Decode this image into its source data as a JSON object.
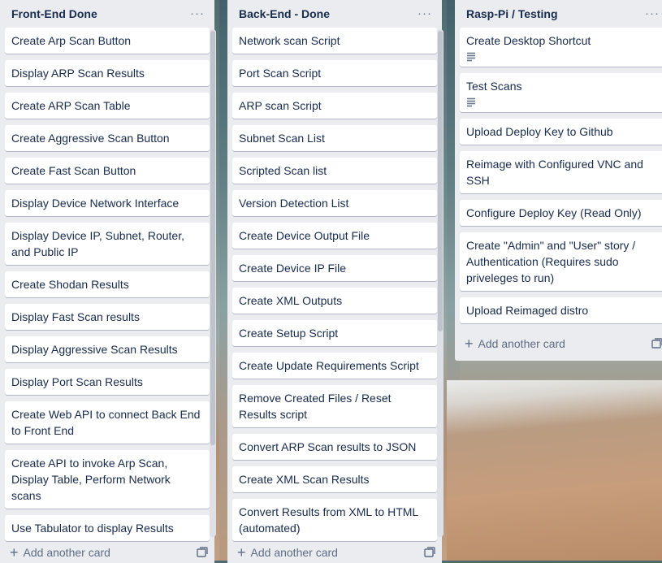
{
  "lists": [
    {
      "title": "Front-End Done",
      "cards": [
        "Create Arp Scan Button",
        "Display ARP Scan Results",
        "Create ARP Scan Table",
        "Create Aggressive Scan Button",
        "Create Fast Scan Button",
        "Display Device Network Interface",
        "Display Device IP, Subnet, Router, and Public IP",
        "Create Shodan Results",
        "Display Fast Scan results",
        "Display Aggressive Scan Results",
        "Display Port Scan Results",
        "Create Web API to connect Back End to Front End",
        "Create API to invoke Arp Scan, Display Table, Perform Network scans",
        "Use Tabulator to display Results"
      ],
      "add_label": "Add another card"
    },
    {
      "title": "Back-End - Done",
      "cards": [
        "Network scan Script",
        "Port Scan Script",
        "ARP scan Script",
        "Subnet Scan List",
        "Scripted Scan list",
        "Version Detection List",
        "Create Device Output File",
        "Create Device IP File",
        "Create XML Outputs",
        "Create Setup Script",
        "Create Update Requirements Script",
        "Remove Created Files / Reset Results script",
        "Convert ARP Scan results to JSON",
        "Create XML Scan Results",
        "Convert Results from XML to HTML (automated)"
      ],
      "add_label": "Add another card"
    },
    {
      "title": "Rasp-Pi / Testing",
      "cards": [
        "Create Desktop Shortcut",
        "Test Scans",
        "Upload Deploy Key to Github",
        "Reimage with Configured VNC and SSH",
        "Configure Deploy Key (Read Only)",
        "Create \"Admin\" and \"User\" story / Authentication (Requires sudo priveleges to run)",
        "Upload Reimaged distro"
      ],
      "cards_with_description": [
        0,
        1
      ],
      "add_label": "Add another card"
    }
  ],
  "icons": {
    "list_menu": "ellipsis-icon",
    "add": "plus-icon",
    "template": "card-template-icon",
    "description": "description-icon"
  }
}
